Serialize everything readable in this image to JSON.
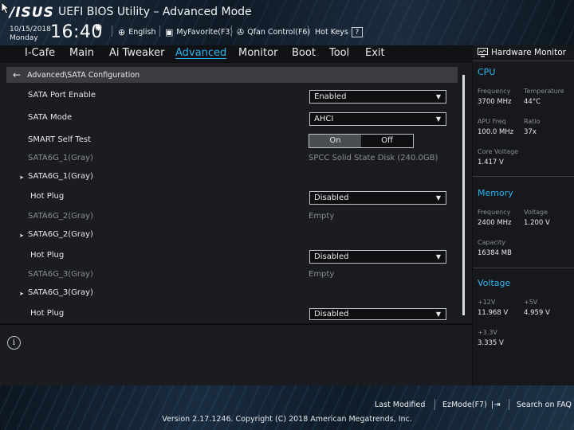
{
  "header": {
    "logo": "/ISUS",
    "title": "UEFI BIOS Utility – Advanced Mode",
    "date": "10/15/2018",
    "weekday": "Monday",
    "time": "16:40",
    "language": "English",
    "myfavorite": "MyFavorite(F3)",
    "qfan": "Qfan Control(F6)",
    "hotkeys": "Hot Keys",
    "hotkeys_key": "?"
  },
  "tabs": [
    "I-Cafe",
    "Main",
    "Ai Tweaker",
    "Advanced",
    "Monitor",
    "Boot",
    "Tool",
    "Exit"
  ],
  "active_tab": "Advanced",
  "breadcrumb": "Advanced\\SATA Configuration",
  "settings": {
    "sata_port_enable": {
      "label": "SATA Port Enable",
      "value": "Enabled"
    },
    "sata_mode": {
      "label": "SATA Mode",
      "value": "AHCI"
    },
    "smart_self_test": {
      "label": "SMART Self Test",
      "on": "On",
      "off": "Off",
      "selected": "On"
    },
    "port1_info": {
      "label": "SATA6G_1(Gray)",
      "value": "SPCC Solid State Disk (240.0GB)"
    },
    "port1_expand": {
      "label": "SATA6G_1(Gray)"
    },
    "port1_hotplug": {
      "label": "Hot Plug",
      "value": "Disabled"
    },
    "port2_info": {
      "label": "SATA6G_2(Gray)",
      "value": "Empty"
    },
    "port2_expand": {
      "label": "SATA6G_2(Gray)"
    },
    "port2_hotplug": {
      "label": "Hot Plug",
      "value": "Disabled"
    },
    "port3_info": {
      "label": "SATA6G_3(Gray)",
      "value": "Empty"
    },
    "port3_expand": {
      "label": "SATA6G_3(Gray)"
    },
    "port3_hotplug": {
      "label": "Hot Plug",
      "value": "Disabled"
    }
  },
  "hardware_monitor": {
    "title": "Hardware Monitor",
    "cpu": {
      "heading": "CPU",
      "frequency_label": "Frequency",
      "frequency": "3700 MHz",
      "temperature_label": "Temperature",
      "temperature": "44°C",
      "apu_freq_label": "APU Freq",
      "apu_freq": "100.0 MHz",
      "ratio_label": "Ratio",
      "ratio": "37x",
      "core_voltage_label": "Core Voltage",
      "core_voltage": "1.417 V"
    },
    "memory": {
      "heading": "Memory",
      "frequency_label": "Frequency",
      "frequency": "2400 MHz",
      "voltage_label": "Voltage",
      "voltage": "1.200 V",
      "capacity_label": "Capacity",
      "capacity": "16384 MB"
    },
    "voltage": {
      "heading": "Voltage",
      "v12_label": "+12V",
      "v12": "11.968 V",
      "v5_label": "+5V",
      "v5": "4.959 V",
      "v33_label": "+3.3V",
      "v33": "3.335 V"
    }
  },
  "footer": {
    "last_modified": "Last Modified",
    "ezmode": "EzMode(F7)",
    "search_faq": "Search on FAQ",
    "copyright": "Version 2.17.1246. Copyright (C) 2018 American Megatrends, Inc."
  },
  "colors": {
    "accent": "#2ab4ef",
    "background": "#1a1c1f",
    "dim_text": "#8a8e93"
  }
}
